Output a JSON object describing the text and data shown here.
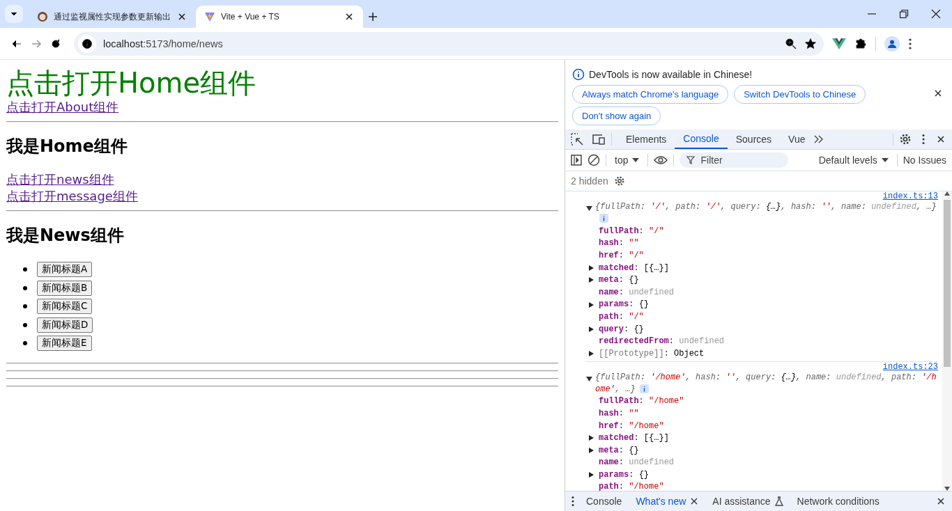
{
  "browser": {
    "tabs": [
      {
        "title": "通过监视属性实现参数更新输出",
        "selected": false,
        "kind": "avatar"
      },
      {
        "title": "Vite + Vue + TS",
        "selected": true,
        "kind": "vite"
      }
    ],
    "address_host": "localhost",
    "address_path": ":5173/home/news"
  },
  "page": {
    "title_link": "点击打开Home组件",
    "about_link": "点击打开About组件",
    "home_heading": "我是Home组件",
    "sub_links": [
      "点击打开news组件",
      "点击打开message组件"
    ],
    "news_heading": "我是News组件",
    "news_buttons": [
      "新闻标题A",
      "新闻标题B",
      "新闻标题C",
      "新闻标题D",
      "新闻标题E"
    ]
  },
  "devtools": {
    "banner": {
      "message": "DevTools is now available in Chinese!",
      "buttons": [
        "Always match Chrome's language",
        "Switch DevTools to Chinese",
        "Don't show again"
      ]
    },
    "tabs": [
      {
        "label": "Elements",
        "selected": false
      },
      {
        "label": "Console",
        "selected": true
      },
      {
        "label": "Sources",
        "selected": false
      },
      {
        "label": "Vue",
        "selected": false
      }
    ],
    "toolbar": {
      "context": "top",
      "filter_placeholder": "Filter",
      "levels": "Default levels",
      "issues": "No Issues"
    },
    "hidden_count": "2 hidden",
    "entries": [
      {
        "source": "index.ts:13",
        "expanded": true,
        "summary": [
          {
            "kind": "punct",
            "text": "{"
          },
          {
            "kind": "key",
            "text": "fullPath"
          },
          {
            "kind": "punct",
            "text": ": "
          },
          {
            "kind": "string",
            "text": "'/'"
          },
          {
            "kind": "punct",
            "text": ", "
          },
          {
            "kind": "key",
            "text": "path"
          },
          {
            "kind": "punct",
            "text": ": "
          },
          {
            "kind": "string",
            "text": "'/'"
          },
          {
            "kind": "punct",
            "text": ", "
          },
          {
            "kind": "key",
            "text": "query"
          },
          {
            "kind": "punct",
            "text": ": "
          },
          {
            "kind": "object",
            "text": "{…}"
          },
          {
            "kind": "punct",
            "text": ", "
          },
          {
            "kind": "key",
            "text": "hash"
          },
          {
            "kind": "punct",
            "text": ": "
          },
          {
            "kind": "string",
            "text": "''"
          },
          {
            "kind": "punct",
            "text": ", "
          },
          {
            "kind": "key",
            "text": "name"
          },
          {
            "kind": "punct",
            "text": ": "
          },
          {
            "kind": "undefined",
            "text": "undefined"
          },
          {
            "kind": "punct",
            "text": ",  …}"
          }
        ],
        "props": [
          {
            "key": "fullPath",
            "punct": ": ",
            "value": "\"/\"",
            "kind": "string",
            "expandable": false,
            "internal": false
          },
          {
            "key": "hash",
            "punct": ": ",
            "value": "\"\"",
            "kind": "string",
            "expandable": false,
            "internal": false
          },
          {
            "key": "href",
            "punct": ": ",
            "value": "\"/\"",
            "kind": "string",
            "expandable": false,
            "internal": false
          },
          {
            "key": "matched",
            "punct": ": ",
            "value": "[{…}]",
            "kind": "object",
            "expandable": true,
            "internal": false
          },
          {
            "key": "meta",
            "punct": ": ",
            "value": "{}",
            "kind": "object",
            "expandable": true,
            "internal": false
          },
          {
            "key": "name",
            "punct": ": ",
            "value": "undefined",
            "kind": "undefined",
            "expandable": false,
            "internal": false
          },
          {
            "key": "params",
            "punct": ": ",
            "value": "{}",
            "kind": "object",
            "expandable": true,
            "internal": false
          },
          {
            "key": "path",
            "punct": ": ",
            "value": "\"/\"",
            "kind": "string",
            "expandable": false,
            "internal": false
          },
          {
            "key": "query",
            "punct": ": ",
            "value": "{}",
            "kind": "object",
            "expandable": true,
            "internal": false
          },
          {
            "key": "redirectedFrom",
            "punct": ": ",
            "value": "undefined",
            "kind": "undefined",
            "expandable": false,
            "internal": false
          },
          {
            "key": "[[Prototype]]",
            "punct": ": ",
            "value": "Object",
            "kind": "object",
            "expandable": true,
            "internal": true
          }
        ]
      },
      {
        "source": "index.ts:23",
        "expanded": true,
        "summary": [
          {
            "kind": "punct",
            "text": "{"
          },
          {
            "kind": "key",
            "text": "fullPath"
          },
          {
            "kind": "punct",
            "text": ": "
          },
          {
            "kind": "string",
            "text": "'/home'"
          },
          {
            "kind": "punct",
            "text": ", "
          },
          {
            "kind": "key",
            "text": "hash"
          },
          {
            "kind": "punct",
            "text": ": "
          },
          {
            "kind": "string",
            "text": "''"
          },
          {
            "kind": "punct",
            "text": ", "
          },
          {
            "kind": "key",
            "text": "query"
          },
          {
            "kind": "punct",
            "text": ": "
          },
          {
            "kind": "object",
            "text": "{…}"
          },
          {
            "kind": "punct",
            "text": ", "
          },
          {
            "kind": "key",
            "text": "name"
          },
          {
            "kind": "punct",
            "text": ": "
          },
          {
            "kind": "undefined",
            "text": "undefined"
          },
          {
            "kind": "punct",
            "text": ", "
          },
          {
            "kind": "key",
            "text": "path"
          },
          {
            "kind": "punct",
            "text": ": "
          },
          {
            "kind": "string",
            "text": "'/home'"
          },
          {
            "kind": "punct",
            "text": ",  …}"
          }
        ],
        "props": [
          {
            "key": "fullPath",
            "punct": ": ",
            "value": "\"/home\"",
            "kind": "string",
            "expandable": false,
            "internal": false
          },
          {
            "key": "hash",
            "punct": ": ",
            "value": "\"\"",
            "kind": "string",
            "expandable": false,
            "internal": false
          },
          {
            "key": "href",
            "punct": ": ",
            "value": "\"/home\"",
            "kind": "string",
            "expandable": false,
            "internal": false
          },
          {
            "key": "matched",
            "punct": ": ",
            "value": "[{…}]",
            "kind": "object",
            "expandable": true,
            "internal": false
          },
          {
            "key": "meta",
            "punct": ": ",
            "value": "{}",
            "kind": "object",
            "expandable": true,
            "internal": false
          },
          {
            "key": "name",
            "punct": ": ",
            "value": "undefined",
            "kind": "undefined",
            "expandable": false,
            "internal": false
          },
          {
            "key": "params",
            "punct": ": ",
            "value": "{}",
            "kind": "object",
            "expandable": true,
            "internal": false
          },
          {
            "key": "path",
            "punct": ": ",
            "value": "\"/home\"",
            "kind": "string",
            "expandable": false,
            "internal": false
          }
        ]
      }
    ],
    "drawer_tabs": [
      {
        "label": "Console",
        "selected": false,
        "closable": false,
        "experimental": false
      },
      {
        "label": "What's new",
        "selected": true,
        "closable": true,
        "experimental": false
      },
      {
        "label": "AI assistance",
        "selected": false,
        "closable": false,
        "experimental": true
      },
      {
        "label": "Network conditions",
        "selected": false,
        "closable": false,
        "experimental": false
      }
    ]
  }
}
